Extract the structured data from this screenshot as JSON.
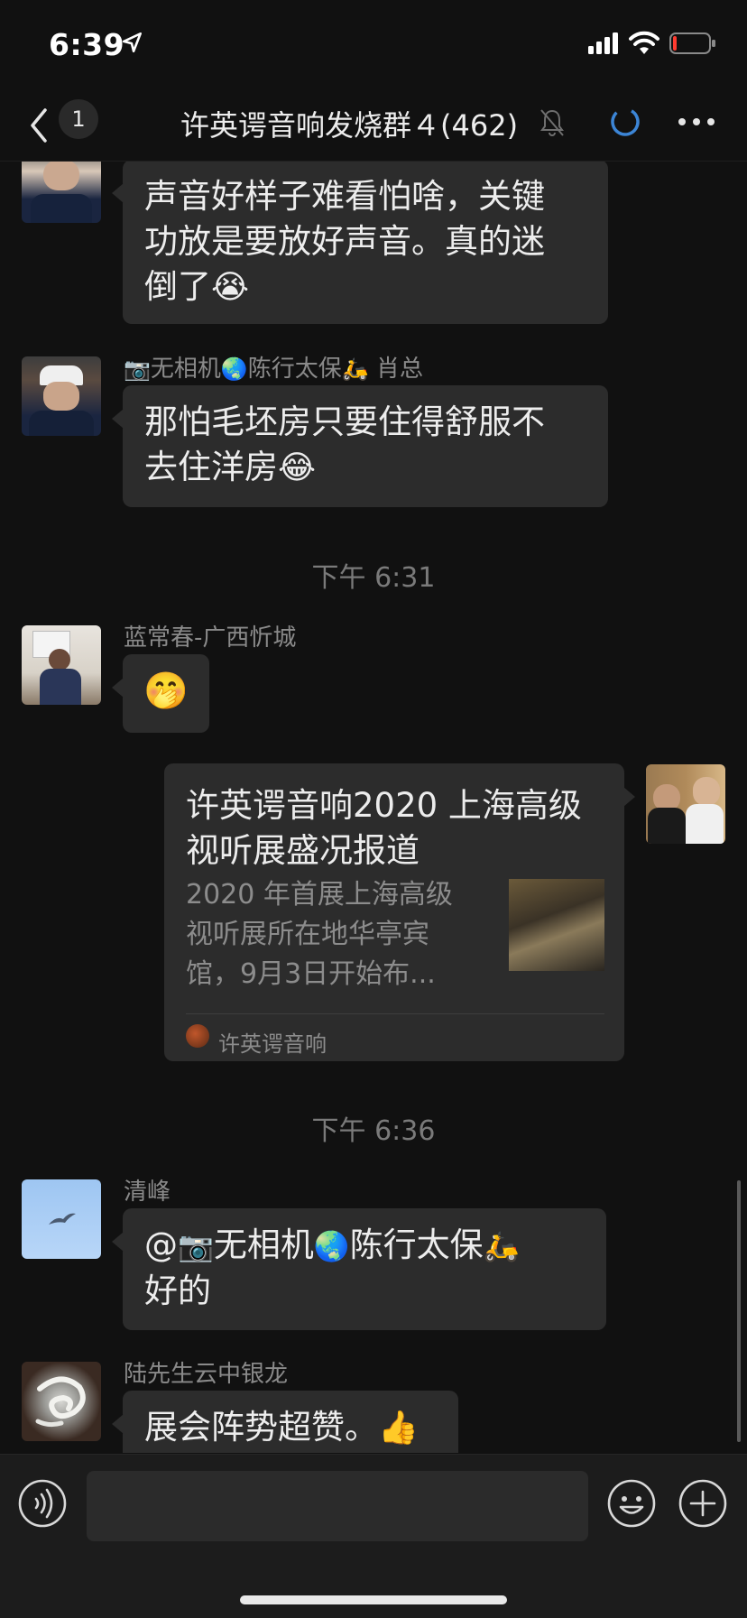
{
  "status": {
    "time": "6:39"
  },
  "nav": {
    "unread": "1",
    "title": "许英谔音响发烧群４(462)"
  },
  "messages": [
    {
      "text1": "声音好样子难看怕啥，关键",
      "text2": "功放是要放好声音。真的迷",
      "text3": "倒了",
      "emoji": "😭"
    },
    {
      "sender_cam": "📷",
      "sender_a": "无相机",
      "sender_globe": "🌏",
      "sender_b": "陈行太保",
      "sender_scooter": "🛵",
      "sender_c": "肖总",
      "text1": "那怕毛坯房只要住得舒服不",
      "text2": "去住洋房",
      "emoji": "😂"
    },
    {
      "time": "下午 6:31"
    },
    {
      "sender": "蓝常春-广西忻城",
      "emoji": "🤭"
    },
    {
      "link_title": "许英谔音响2020 上海高级视听展盛况报道",
      "link_desc": "2020 年首展上海高级视听展所在地华亭宾馆，9月3日开始布...",
      "link_source": "许英谔音响"
    },
    {
      "time": "下午 6:36"
    },
    {
      "sender": "清峰",
      "at": "@",
      "cam": "📷",
      "name_a": "无相机",
      "globe": "🌏",
      "name_b": "陈行太保",
      "scooter": "🛵",
      "text2": "好的"
    },
    {
      "sender": "陆先生云中银龙",
      "text": "展会阵势超赞。",
      "emoji": "👍"
    }
  ]
}
